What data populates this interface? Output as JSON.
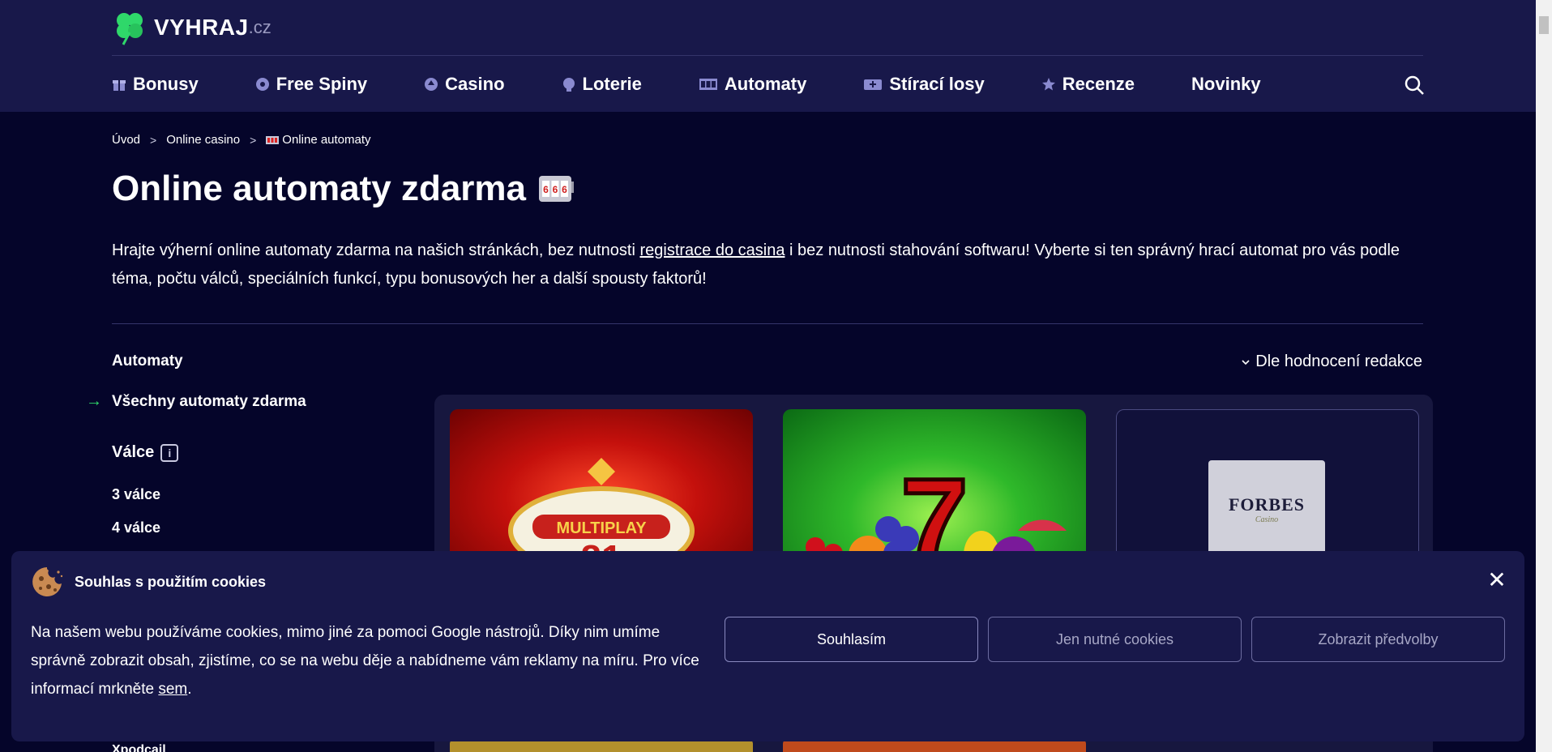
{
  "header": {
    "logo": {
      "brand": "VYHRAJ",
      "tld": ".cz"
    },
    "nav": [
      {
        "label": "Bonusy",
        "icon": "gift-icon"
      },
      {
        "label": "Free Spiny",
        "icon": "spin-wheel-icon"
      },
      {
        "label": "Casino",
        "icon": "spade-chip-icon"
      },
      {
        "label": "Loterie",
        "icon": "lottery-ball-icon"
      },
      {
        "label": "Automaty",
        "icon": "slot-machine-icon"
      },
      {
        "label": "Stírací losy",
        "icon": "scratch-ticket-icon"
      },
      {
        "label": "Recenze",
        "icon": "star-icon"
      },
      {
        "label": "Novinky",
        "icon": ""
      }
    ],
    "search_icon": "search-icon"
  },
  "breadcrumb": {
    "items": [
      "Úvod",
      "Online casino",
      "Online automaty"
    ],
    "separator": ">"
  },
  "page": {
    "title": "Online automaty zdarma",
    "intro_part1": "Hrajte výherní online automaty zdarma na našich stránkách, bez nutnosti ",
    "intro_link": "registrace do casina",
    "intro_part2": " i bez nutnosti stahování softwaru! Vyberte si ten správný hrací automat pro vás podle téma, počtu válců, speciálních funkcí, typu bonusových her a další spousty faktorů!"
  },
  "sidebar": {
    "heading": "Automaty",
    "active_item": "Všechny automaty zdarma",
    "group_label": "Válce",
    "links": [
      "3 válce",
      "4 válce"
    ],
    "peek_text": "Xpodcail"
  },
  "sort": {
    "label": "Dle hodnocení redakce"
  },
  "games": [
    {
      "name": "Multiplay 81",
      "sign_top": "MULTIPLAY",
      "sign_number": "81"
    },
    {
      "name": "Sevens fruits",
      "symbol": "7"
    },
    {
      "name": "Forbes Casino",
      "logo_text": "FORBES",
      "logo_sub": "Casino"
    }
  ],
  "cookie": {
    "title": "Souhlas s použitím cookies",
    "text_part1": "Na našem webu používáme cookies, mimo jiné za pomoci Google nástrojů. Díky nim umíme správně zobrazit obsah, zjistíme, co se na webu děje a nabídneme vám reklamy na míru. Pro více informací mrkněte ",
    "text_link": "sem",
    "text_part2": ".",
    "buttons": {
      "accept": "Souhlasím",
      "necessary": "Jen nutné cookies",
      "preferences": "Zobrazit předvolby"
    },
    "close_symbol": "✕"
  },
  "colors": {
    "page_bg": "#05052a",
    "header_bg": "#18184a",
    "panel_bg": "#17173f",
    "accent_green": "#2fd86a",
    "muted_text": "#a7a7c6"
  }
}
